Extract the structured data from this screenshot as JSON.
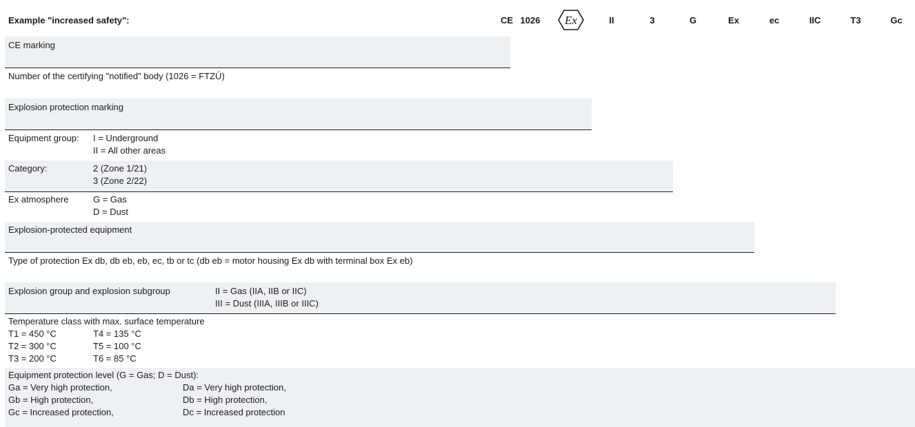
{
  "title": "Example \"increased safety\":",
  "header_codes": [
    "CE",
    "1026",
    "II",
    "3",
    "G",
    "Ex",
    "ec",
    "IIC",
    "T3",
    "Gc"
  ],
  "ex_symbol": {
    "icon": "ex-hexagon-icon",
    "text": "Ex"
  },
  "rows": {
    "ce": "CE marking",
    "body": "Number of the certifying \"notified\" body (1026 = FTZÚ)",
    "expmark": "Explosion protection marking",
    "group": {
      "label": "Equipment group:",
      "line1": "I = Underground",
      "line2": "II = All other areas"
    },
    "category": {
      "label": "Category:",
      "line1": "2 (Zone 1/21)",
      "line2": "3 (Zone 2/22)"
    },
    "atmosphere": {
      "label": "Ex atmosphere",
      "line1": "G = Gas",
      "line2": "D = Dust"
    },
    "equipment": "Explosion-protected equipment",
    "protection_type": "Type of protection Ex db, db eb, eb, ec, tb or tc (db eb = motor housing Ex db with terminal box Ex eb)",
    "expl_group": {
      "label": "Explosion group and explosion subgroup",
      "line1": "II = Gas (IIA, IIB or IIC)",
      "line2": "III = Dust (IIIA, IIIB or IIIC)"
    },
    "temp": {
      "label": "Temperature class with max. surface temperature",
      "c1": [
        "T1 = 450 °C",
        "T2 = 300 °C",
        "T3 = 200 °C"
      ],
      "c2": [
        "T4 = 135 °C",
        "T5 = 100 °C",
        "T6 = 85 °C"
      ]
    },
    "epl": {
      "label": "Equipment protection level (G = Gas; D = Dust):",
      "c1": [
        "Ga = Very high protection,",
        "Gb = High protection,",
        "Gc = Increased protection,"
      ],
      "c2": [
        "Da = Very high protection,",
        "Db = High protection,",
        "Dc = Increased protection"
      ]
    }
  }
}
